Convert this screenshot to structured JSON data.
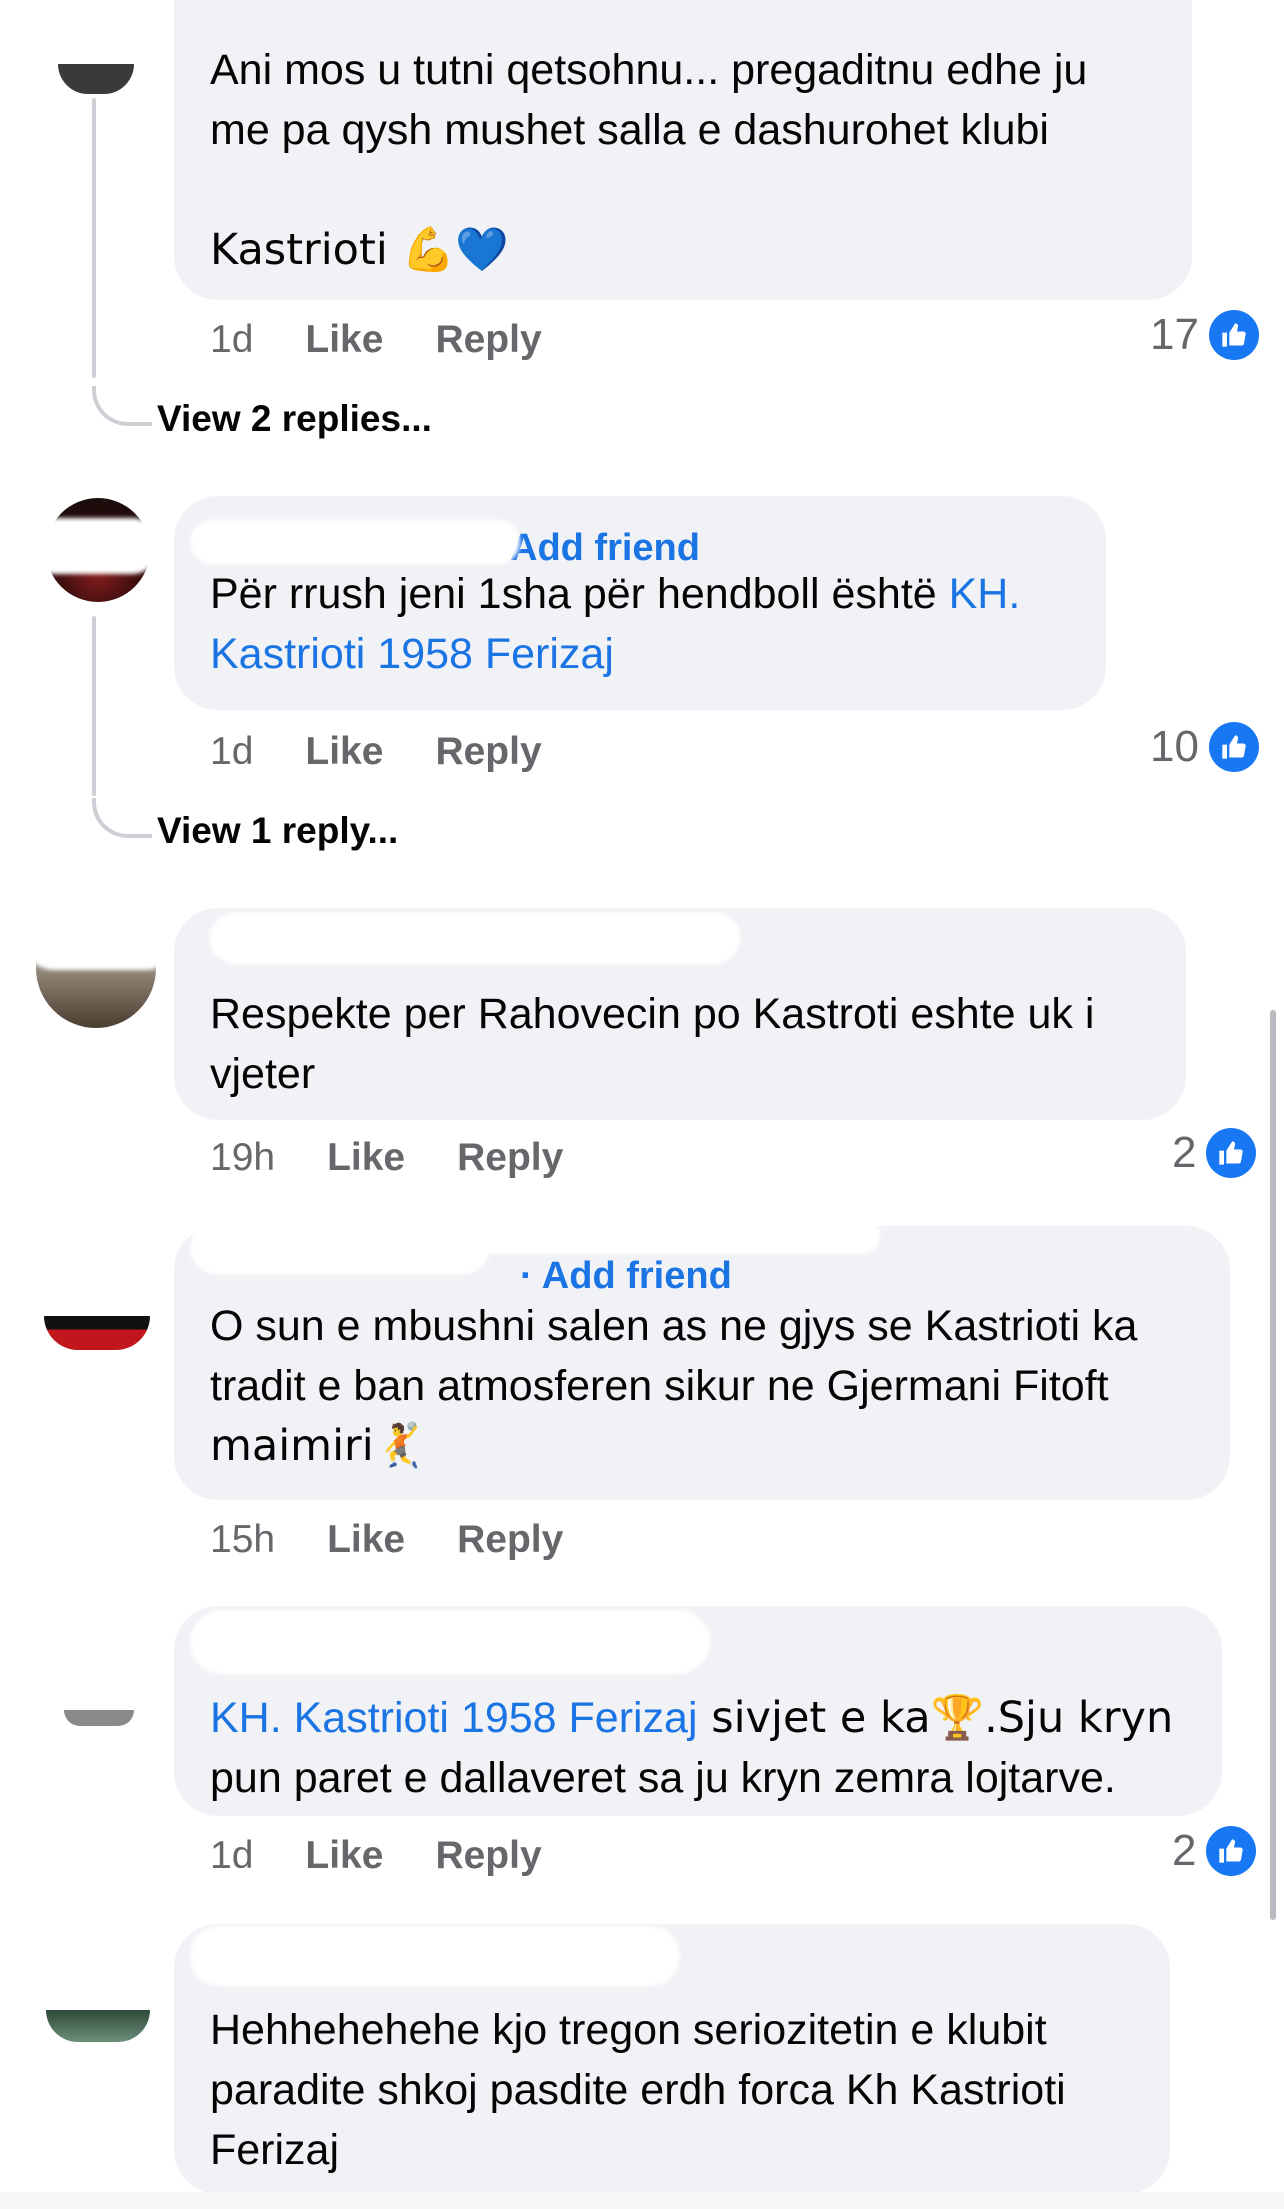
{
  "comments": [
    {
      "id": "c1",
      "text_line1": "Ani mos u tutni qetsohnu... pregaditnu edhe ju",
      "text_line2": "me pa qysh mushet salla e dashurohet klubi",
      "text_line3": "Kastrioti 💪💙",
      "time": "1d",
      "like_label": "Like",
      "reply_label": "Reply",
      "reactions": "17",
      "view_replies": "View 2 replies..."
    },
    {
      "id": "c2",
      "name_suffix": "Add friend",
      "text_prefix": "Për rrush jeni 1sha për hendboll është ",
      "mention_part1": "KH.",
      "mention_part2": "Kastrioti 1958 Ferizaj",
      "time": "1d",
      "like_label": "Like",
      "reply_label": "Reply",
      "reactions": "10",
      "view_replies": "View 1 reply..."
    },
    {
      "id": "c3",
      "text_line1": "Respekte per Rahovecin po Kastroti eshte uk i",
      "text_line2": "vjeter",
      "time": "19h",
      "like_label": "Like",
      "reply_label": "Reply",
      "reactions": "2"
    },
    {
      "id": "c4",
      "name_suffix": "· Add friend",
      "text_line1": "O sun e mbushni salen as ne gjys se Kastrioti ka",
      "text_line2": "tradit e ban atmosferen sikur ne Gjermani Fitoft",
      "text_line3": "maimiri🤾",
      "time": "15h",
      "like_label": "Like",
      "reply_label": "Reply"
    },
    {
      "id": "c5",
      "mention": "KH. Kastrioti 1958 Ferizaj",
      "text_after_mention": " sivjet e ka🏆.Sju kryn",
      "text_line2": "pun paret e dallaveret sa ju kryn zemra lojtarve.",
      "time": "1d",
      "like_label": "Like",
      "reply_label": "Reply",
      "reactions": "2"
    },
    {
      "id": "c6",
      "text_line1": "Hehhehehehe kjo tregon seriozitetin e klubit",
      "text_line2": "paradite shkoj pasdite erdh forca Kh Kastrioti",
      "text_line3": "Ferizaj"
    }
  ],
  "colors": {
    "bubble": "#f0f2f5",
    "link": "#1b74e4",
    "like_badge": "#1877f2",
    "meta_text": "#65676b"
  },
  "icons": {
    "like_badge": "thumbs-up-icon"
  }
}
